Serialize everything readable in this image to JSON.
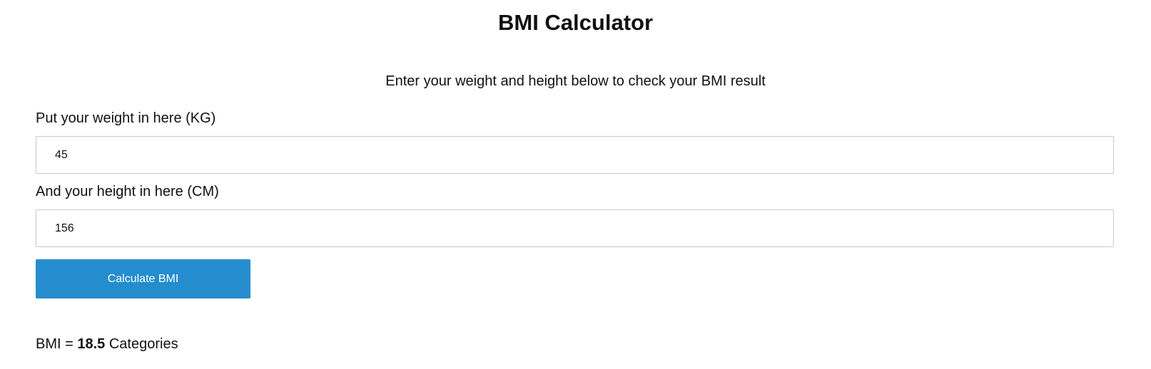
{
  "page": {
    "title": "BMI Calculator",
    "intro": "Enter your weight and height below to check your BMI result"
  },
  "form": {
    "weight_label": "Put your weight in here (KG)",
    "weight_value": "45",
    "height_label": "And your height in here (CM)",
    "height_value": "156",
    "calculate_label": "Calculate BMI"
  },
  "result": {
    "prefix": "BMI = ",
    "value": "18.5",
    "suffix": " Categories"
  },
  "colors": {
    "button_background": "#258dcd",
    "button_text": "#ffffff",
    "input_border": "#c9c9c9"
  }
}
